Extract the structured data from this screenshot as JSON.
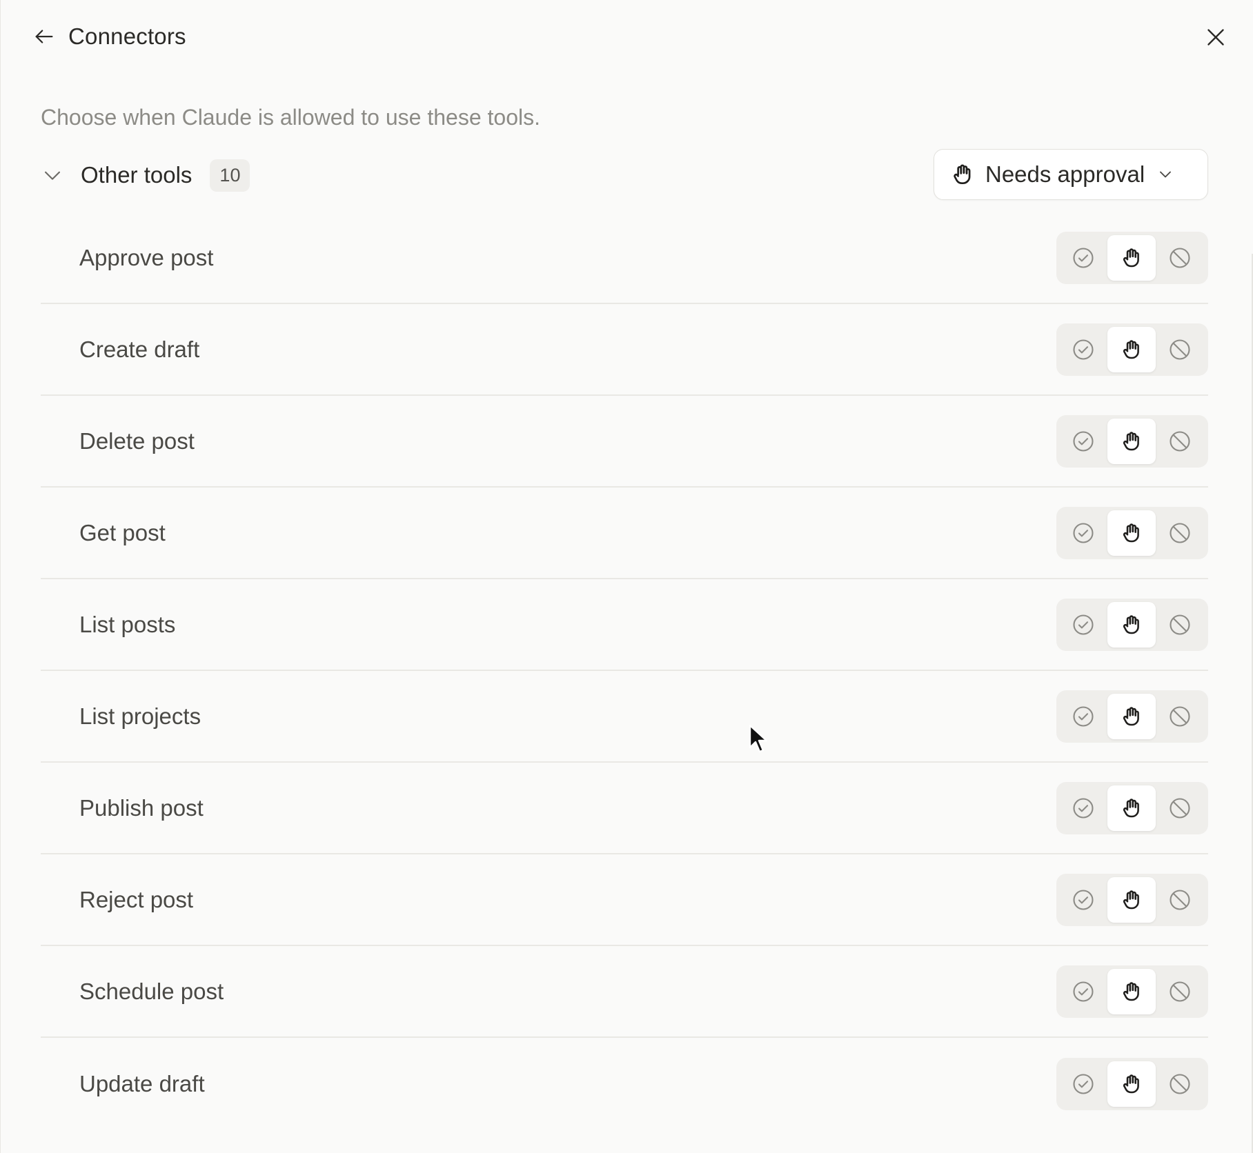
{
  "header": {
    "back_icon": "arrow-left-icon",
    "title": "Connectors",
    "close_icon": "close-icon"
  },
  "subtitle": "Choose when Claude is allowed to use these tools.",
  "group": {
    "label": "Other tools",
    "count": "10",
    "expanded": true,
    "dropdown": {
      "icon": "hand-icon",
      "selected": "Needs approval"
    }
  },
  "tools": [
    {
      "label": "Approve post",
      "permission": "needs-approval"
    },
    {
      "label": "Create draft",
      "permission": "needs-approval"
    },
    {
      "label": "Delete post",
      "permission": "needs-approval"
    },
    {
      "label": "Get post",
      "permission": "needs-approval"
    },
    {
      "label": "List posts",
      "permission": "needs-approval"
    },
    {
      "label": "List projects",
      "permission": "needs-approval"
    },
    {
      "label": "Publish post",
      "permission": "needs-approval"
    },
    {
      "label": "Reject post",
      "permission": "needs-approval"
    },
    {
      "label": "Schedule post",
      "permission": "needs-approval"
    },
    {
      "label": "Update draft",
      "permission": "needs-approval"
    }
  ],
  "permission_options": [
    {
      "id": "always-allow",
      "icon": "check-circle-icon"
    },
    {
      "id": "needs-approval",
      "icon": "hand-icon"
    },
    {
      "id": "blocked",
      "icon": "block-icon"
    }
  ],
  "colors": {
    "background": "#fafaf9",
    "text": "#2b2a27",
    "muted": "#8c8b86",
    "segment_bg": "#efeeeb",
    "divider": "#e9e8e4"
  }
}
